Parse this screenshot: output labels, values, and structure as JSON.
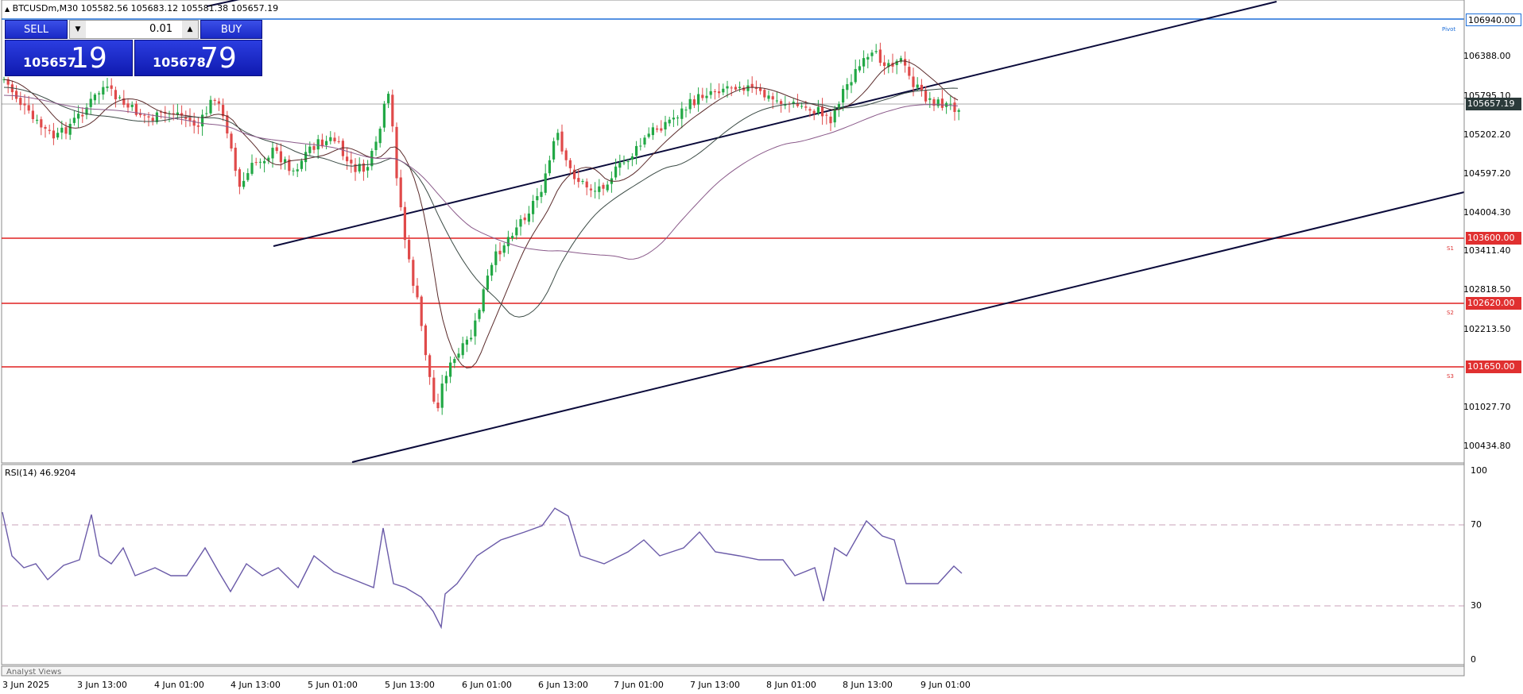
{
  "header": {
    "symbol_line": "BTCUSDm,M30  105582.56 105683.12 105581.38 105657.19"
  },
  "trade_panel": {
    "sell_label": "SELL",
    "buy_label": "BUY",
    "lot_value": "0.01",
    "sell_price_small": "105657",
    "sell_price_big": "19",
    "buy_price_small": "105678",
    "buy_price_big": "79"
  },
  "price_axis": {
    "labels": [
      "106388.00",
      "105795.10",
      "105202.20",
      "104597.20",
      "104004.30",
      "103411.40",
      "102818.50",
      "102213.50",
      "101027.70",
      "100434.80"
    ],
    "tags": {
      "pivot": "106940.00",
      "current": "105657.19",
      "s1": "103600.00",
      "s2": "102620.00",
      "s3": "101650.00"
    },
    "line_names": {
      "pivot": "Pivot",
      "s1": "S1",
      "s2": "S2",
      "s3": "S3"
    }
  },
  "time_axis": {
    "labels": [
      "3 Jun 2025",
      "3 Jun 13:00",
      "4 Jun 01:00",
      "4 Jun 13:00",
      "5 Jun 01:00",
      "5 Jun 13:00",
      "6 Jun 01:00",
      "6 Jun 13:00",
      "7 Jun 01:00",
      "7 Jun 13:00",
      "8 Jun 01:00",
      "8 Jun 13:00",
      "9 Jun 01:00"
    ]
  },
  "rsi": {
    "title": "RSI(14) 46.9204",
    "levels": [
      "100",
      "70",
      "30",
      "0"
    ]
  },
  "footer": {
    "analyst_views": "Analyst Views"
  },
  "colors": {
    "bull": "#22a845",
    "bear": "#e04a4a",
    "pivot_line": "#1e6fd9",
    "support_line": "#e02020",
    "trend_line": "#0a0a3a",
    "rsi_line": "#6a5aa8",
    "tag_red": "#e03030",
    "tag_dark": "#2b3a3a"
  }
}
